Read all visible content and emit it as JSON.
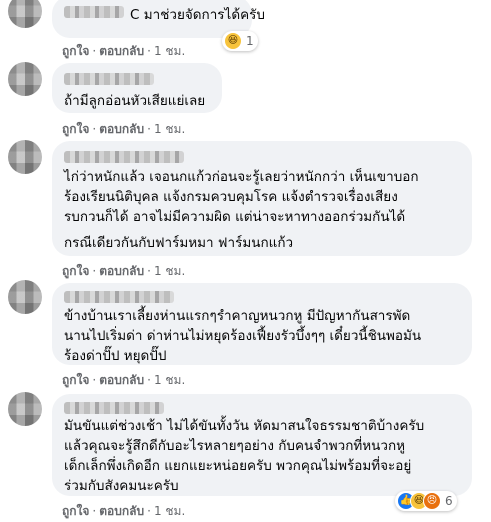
{
  "comments": [
    {
      "lines": [
        "C มาช่วยจัดการได้ครับ"
      ],
      "like_label": "ถูกใจ",
      "reply_label": "ตอบกลับ",
      "time": "1 ชม.",
      "reactions": {
        "icons": [
          "haha-icon"
        ],
        "count": "1"
      }
    },
    {
      "lines": [
        "ถ้ามีลูกอ่อนหัวเสียแย่เลย"
      ],
      "like_label": "ถูกใจ",
      "reply_label": "ตอบกลับ",
      "time": "1 ชม."
    },
    {
      "lines": [
        "ไก่ว่าหนักแล้ว เจอนกแก้วก่อนจะรู้เลยว่าหนักกว่า เห็นเขาบอก",
        "ร้องเรียนนิติบุคล แจ้งกรมควบคุมโรค แจ้งตำรวจเรื่องเสียง",
        "รบกวนก็ได้ อาจไม่มีความผิด แต่น่าจะหาทางออกร่วมกันได้",
        "กรณีเดียวกันกับฟาร์มหมา ฟาร์มนกแก้ว"
      ],
      "like_label": "ถูกใจ",
      "reply_label": "ตอบกลับ",
      "time": "1 ชม."
    },
    {
      "lines": [
        "ข้างบ้านเราเลี้ยงห่านแรกๆรำคาญหนวกหู มีปัญหากันสารพัด",
        "นานไปเริ่มด่า ด่าห่านไม่หยุดร้องเฟี้ยงรัวบึ้งๆๆ เดี๋ยวนี้ชินพอมัน",
        "ร้องด่าปั๊ป หยุดปั๊ป"
      ],
      "like_label": "ถูกใจ",
      "reply_label": "ตอบกลับ",
      "time": "1 ชม."
    },
    {
      "lines": [
        "มันขันแต่ช่วงเช้า ไม่ได้ขันทั้งวัน หัดมาสนใจธรรมชาติบ้างครับ",
        "แล้วคุณจะรู้สึกดีกับอะไรหลายๆอย่าง กับคนจำพวกที่หนวกหู",
        "เด็กเล็กพึ่งเกิดอีก แยกแยะหน่อยครับ พวกคุณไม่พร้อมที่จะอยู่",
        "ร่วมกับสังคมนะครับ"
      ],
      "like_label": "ถูกใจ",
      "reply_label": "ตอบกลับ",
      "time": "1 ชม.",
      "reactions": {
        "icons": [
          "like-icon",
          "haha-icon",
          "angry-icon"
        ],
        "count": "6"
      }
    }
  ],
  "colors": {
    "bubble": "#f0f2f5",
    "meta": "#65676b",
    "text": "#050505"
  }
}
